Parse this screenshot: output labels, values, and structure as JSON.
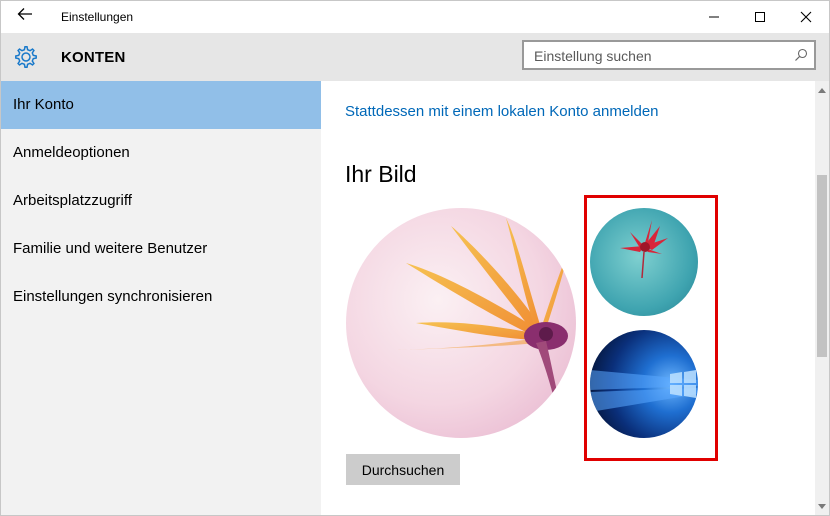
{
  "window": {
    "title": "Einstellungen"
  },
  "header": {
    "section_title": "KONTEN",
    "search_placeholder": "Einstellung suchen",
    "search_value": ""
  },
  "sidebar": {
    "items": [
      {
        "label": "Ihr Konto",
        "selected": true
      },
      {
        "label": "Anmeldeoptionen",
        "selected": false
      },
      {
        "label": "Arbeitsplatzzugriff",
        "selected": false
      },
      {
        "label": "Familie und weitere Benutzer",
        "selected": false
      },
      {
        "label": "Einstellungen synchronisieren",
        "selected": false
      }
    ]
  },
  "content": {
    "local_account_link": "Stattdessen mit einem lokalen Konto anmelden",
    "picture_heading": "Ihr Bild",
    "browse_button": "Durchsuchen"
  },
  "icons": {
    "back": "back-arrow-icon",
    "minimize": "minimize-icon",
    "maximize": "maximize-icon",
    "close": "close-icon",
    "settings": "gear-icon",
    "search": "search-icon"
  },
  "colors": {
    "accent": "#0068b8",
    "selected_nav": "#91bfe8",
    "highlight_border": "#e00000",
    "header_band": "#e6e6e6",
    "sidebar_bg": "#f2f2f2",
    "gear": "#1979ca"
  }
}
